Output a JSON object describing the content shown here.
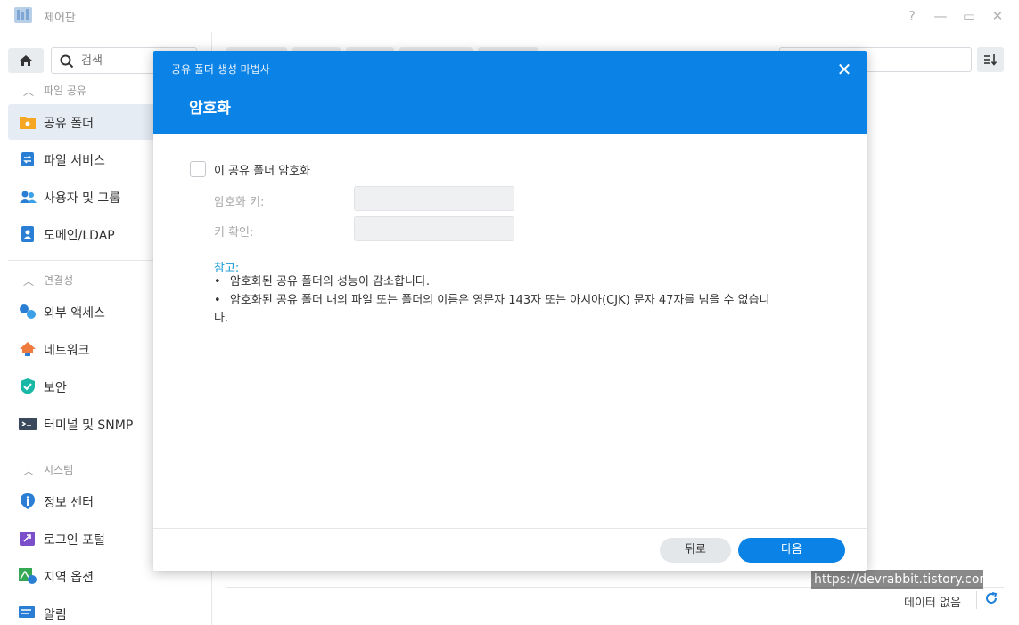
{
  "window": {
    "title": "제어판",
    "help": "?",
    "minimize": "—",
    "maximize": "▭",
    "close": "✕"
  },
  "sidebar": {
    "search_placeholder": "검색",
    "sections": [
      {
        "label": "파일 공유",
        "items": [
          {
            "label": "공유 폴더",
            "icon": "folder-share-icon",
            "active": true
          },
          {
            "label": "파일 서비스",
            "icon": "file-services-icon"
          },
          {
            "label": "사용자 및 그룹",
            "icon": "users-group-icon"
          },
          {
            "label": "도메인/LDAP",
            "icon": "domain-ldap-icon"
          }
        ]
      },
      {
        "label": "연결성",
        "items": [
          {
            "label": "외부 액세스",
            "icon": "external-access-icon"
          },
          {
            "label": "네트워크",
            "icon": "network-icon"
          },
          {
            "label": "보안",
            "icon": "shield-icon"
          },
          {
            "label": "터미널 및 SNMP",
            "icon": "terminal-icon"
          }
        ]
      },
      {
        "label": "시스템",
        "items": [
          {
            "label": "정보 센터",
            "icon": "info-center-icon"
          },
          {
            "label": "로그인 포털",
            "icon": "login-portal-icon"
          },
          {
            "label": "지역 옵션",
            "icon": "regional-options-icon"
          },
          {
            "label": "알림",
            "icon": "notification-icon"
          }
        ]
      }
    ]
  },
  "content": {
    "status": "데이터 없음",
    "refresh": "C"
  },
  "watermark": "https://devrabbit.tistory.com",
  "dialog": {
    "wizard_title": "공유 폴더 생성 마법사",
    "step_title": "암호화",
    "close": "✕",
    "encrypt_checkbox_label": "이 공유 폴더 암호화",
    "encrypt_checked": false,
    "key_label": "암호화 키:",
    "key_confirm_label": "키 확인:",
    "key_value": "",
    "key_confirm_value": "",
    "note_title": "참고:",
    "notes": [
      "암호화된 공유 폴더의 성능이 감소합니다.",
      "암호화된 공유 폴더 내의 파일 또는 폴더의 이름은 영문자 143자 또는 아시아(CJK) 문자 47자를 넘을 수 없습니",
      "다."
    ],
    "bullet": "•",
    "back_button": "뒤로",
    "next_button": "다음"
  },
  "colors": {
    "accent": "#0a82e6",
    "note_title": "#1a9bd8",
    "active_item_bg": "#e5ecf4"
  }
}
